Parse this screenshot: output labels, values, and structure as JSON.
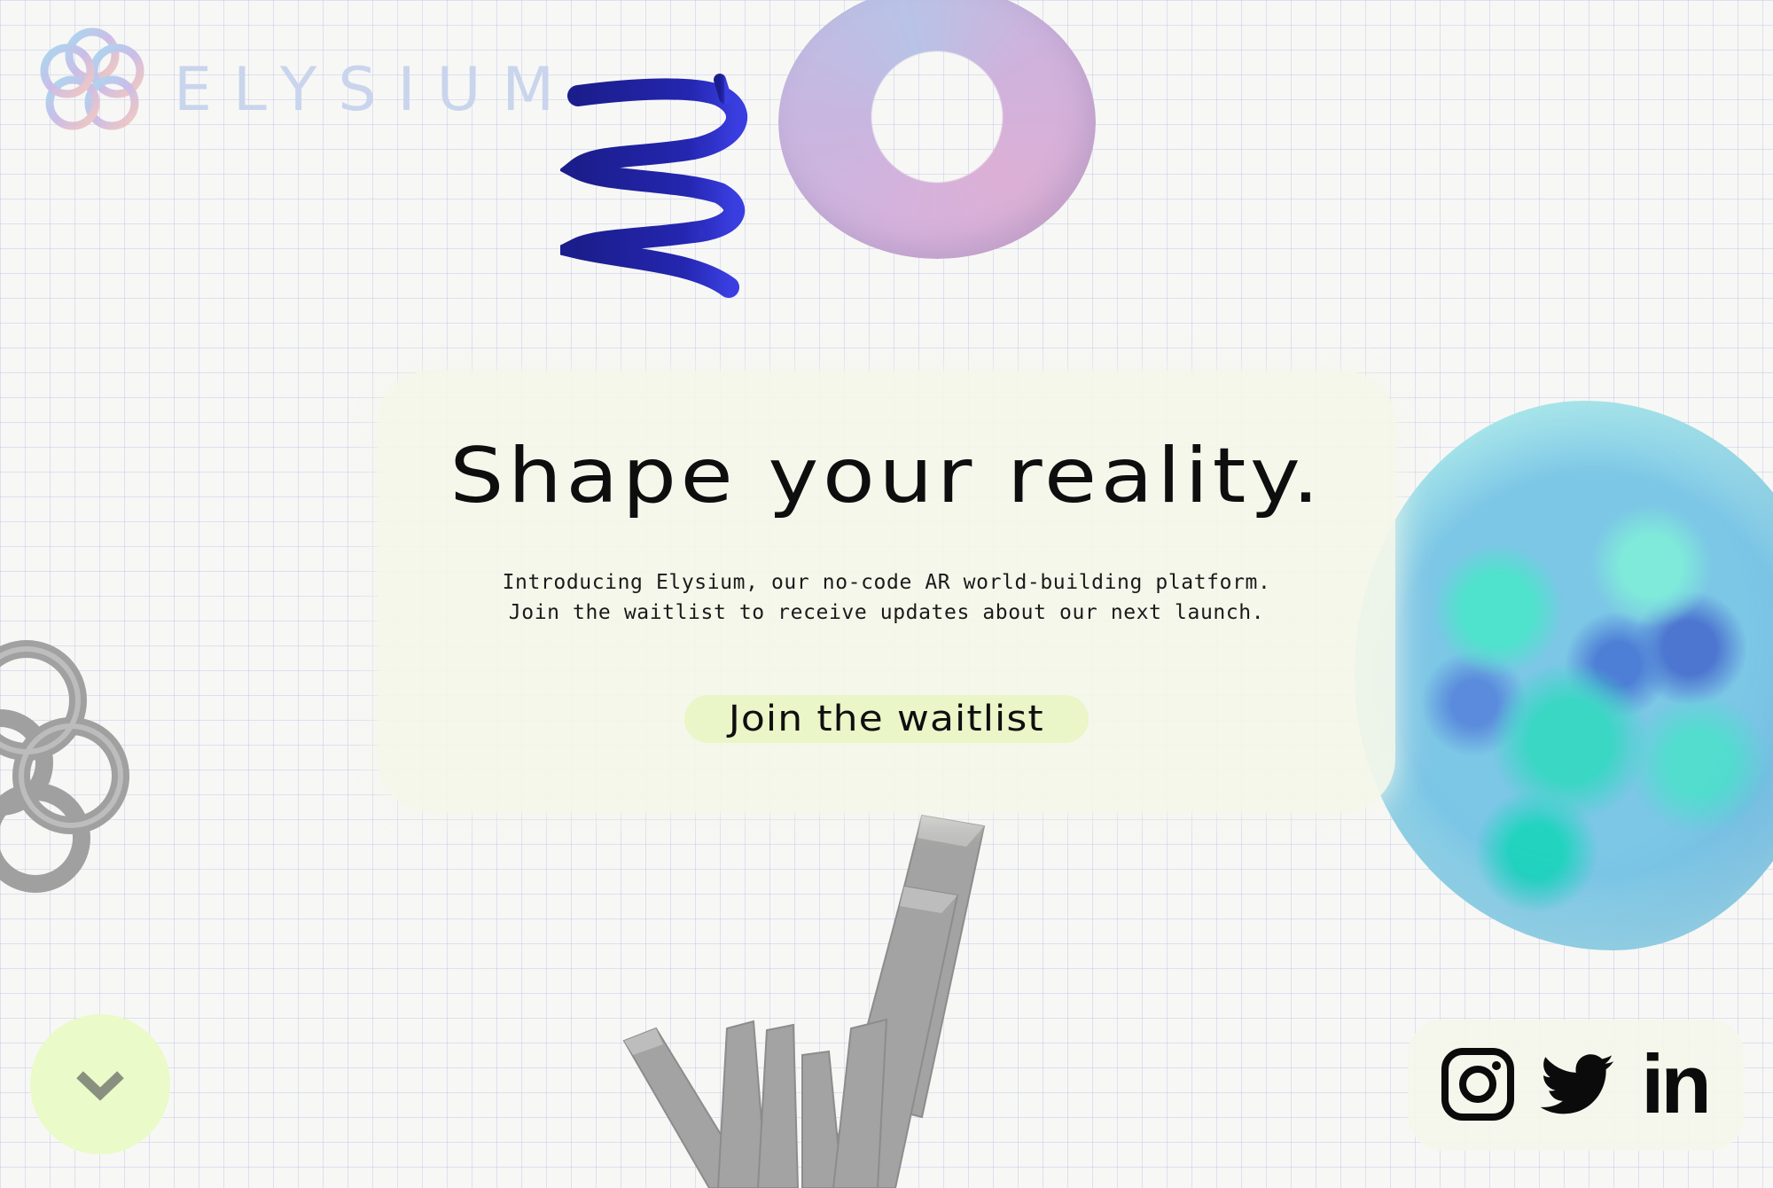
{
  "brand": {
    "name": "ELYSIUM",
    "logo_icon": "flower-knot-logo-icon"
  },
  "hero": {
    "title": "Shape your reality.",
    "subtitle_line1": "Introducing Elysium, our no-code AR world-building platform.",
    "subtitle_line2": "Join the waitlist to receive updates about our next launch.",
    "cta_label": "Join the waitlist"
  },
  "scroll": {
    "icon": "chevron-down-icon"
  },
  "social": {
    "items": [
      "instagram-icon",
      "twitter-icon",
      "linkedin-icon"
    ],
    "linkedin_label": "in"
  },
  "colors": {
    "background": "#f7f7f5",
    "grid": "#b4bae6",
    "card": "#f4f6ea",
    "cta": "#eaf5c8",
    "scroll_button": "#eafac8",
    "spring": "#1a1c9c",
    "text": "#0e0e0e"
  },
  "decorations": [
    "blue-spring-3d",
    "pink-torus-3d",
    "iridescent-blob-3d",
    "gray-knot-3d",
    "gray-crystal-3d"
  ]
}
